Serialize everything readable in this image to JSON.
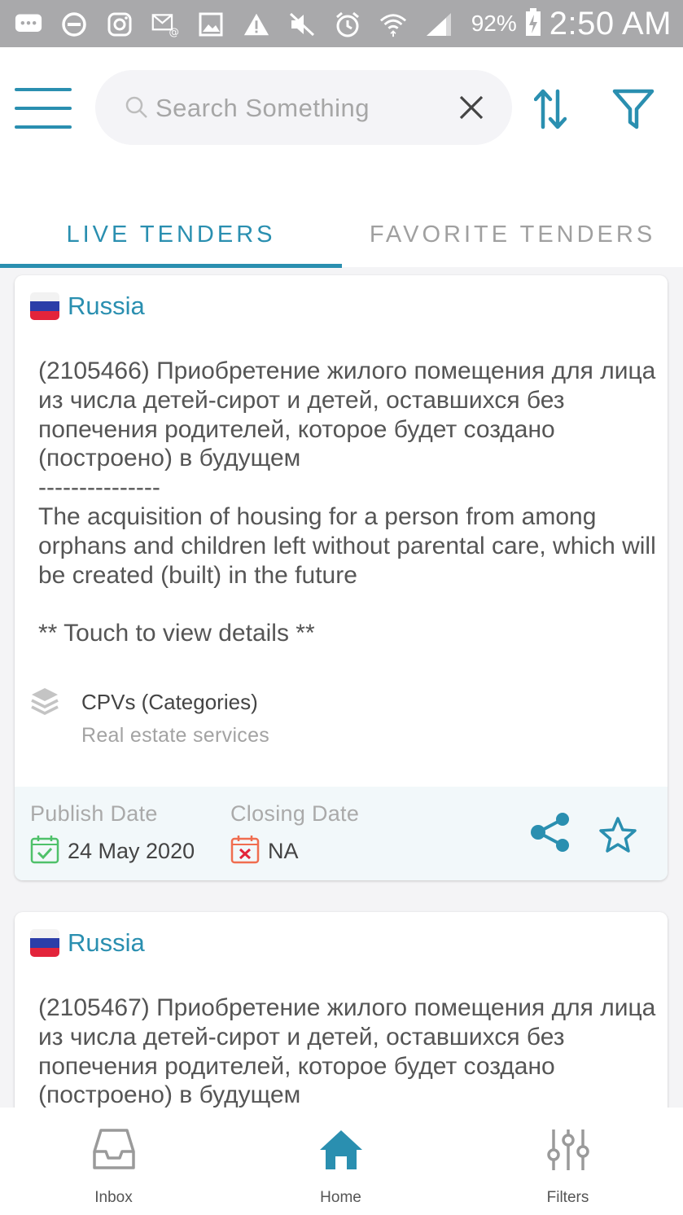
{
  "status_bar": {
    "icons": [
      "message-icon",
      "do-not-disturb-icon",
      "instagram-icon",
      "email-icon",
      "image-icon",
      "warning-icon",
      "mute-icon",
      "alarm-icon",
      "wifi-icon",
      "signal-icon"
    ],
    "battery_text": "92%",
    "time": "2:50 AM"
  },
  "header": {
    "search_placeholder": "Search Something",
    "tabs": [
      {
        "label": "LIVE TENDERS",
        "active": true
      },
      {
        "label": "FAVORITE TENDERS",
        "active": false
      }
    ]
  },
  "colors": {
    "accent": "#2a8fb0",
    "status_bar": "#a9a9ab",
    "publish_icon": "#4fc16a",
    "closing_icon": "#f06d4f"
  },
  "tenders": [
    {
      "country": "Russia",
      "description": "(2105466) Приобретение жилого помещения для лица из числа детей-сирот и детей, оставшихся без попечения родителей, которое будет создано (построено) в будущем\n---------------\nThe acquisition of housing for a person from among orphans and children left without parental care, which will be created (built) in the future\n\n** Touch to view details **",
      "cpv_label": "CPVs (Categories)",
      "cpv_value": "Real estate services",
      "publish_label": "Publish Date",
      "publish_date": "24 May 2020",
      "closing_label": "Closing Date",
      "closing_date": "NA"
    },
    {
      "country": "Russia",
      "description": "(2105467) Приобретение жилого помещения для лица из числа детей-сирот и детей, оставшихся без попечения родителей, которое будет создано (построено) в будущем"
    }
  ],
  "bottom_nav": [
    {
      "label": "Inbox",
      "active": false
    },
    {
      "label": "Home",
      "active": true
    },
    {
      "label": "Filters",
      "active": false
    }
  ]
}
